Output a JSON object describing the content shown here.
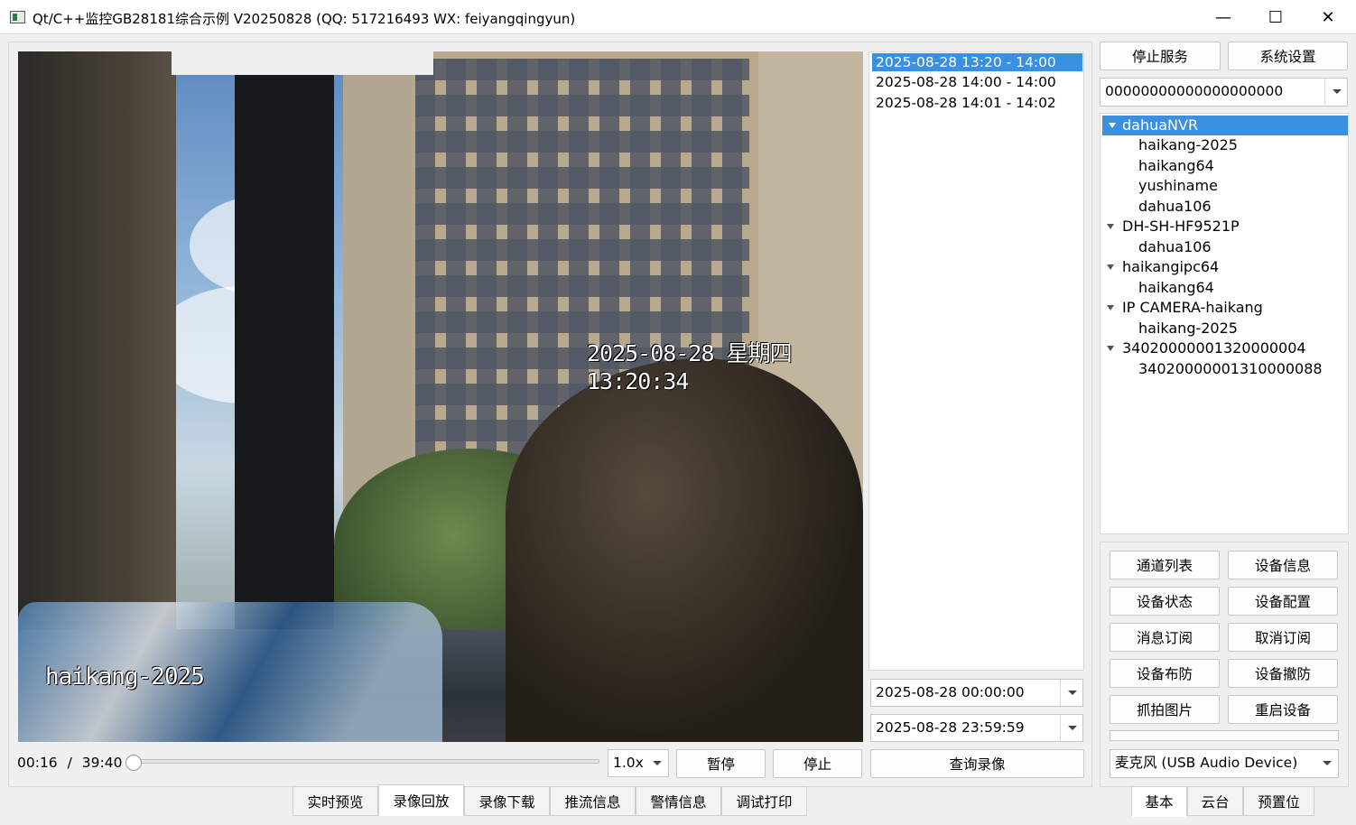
{
  "window": {
    "title": "Qt/C++监控GB28181综合示例 V20250828 (QQ: 517216493 WX: feiyangqingyun)",
    "minimize_glyph": "—",
    "maximize_glyph": "☐",
    "close_glyph": "✕"
  },
  "video": {
    "osd_time": "2025-08-28 星期四 13:20:34",
    "osd_name": "haikang-2025"
  },
  "records": [
    {
      "label": "2025-08-28 13:20 - 14:00",
      "selected": true
    },
    {
      "label": "2025-08-28 14:00 - 14:00",
      "selected": false
    },
    {
      "label": "2025-08-28 14:01 - 14:02",
      "selected": false
    }
  ],
  "query": {
    "start_time": "2025-08-28 00:00:00",
    "end_time": "2025-08-28 23:59:59",
    "query_button": "查询录像"
  },
  "playback": {
    "position": "00:16",
    "separator": "/",
    "duration": "39:40",
    "progress": 0.0067,
    "speed": "1.0x",
    "pause_button": "暂停",
    "stop_button": "停止"
  },
  "bottom_tabs": [
    "实时预览",
    "录像回放",
    "录像下载",
    "推流信息",
    "警情信息",
    "调试打印"
  ],
  "bottom_tab_active": 1,
  "right": {
    "stop_service": "停止服务",
    "system_settings": "系统设置",
    "device_id": "00000000000000000000",
    "tree": [
      {
        "label": "dahuaNVR",
        "level": 0,
        "expanded": true,
        "selected": true
      },
      {
        "label": "haikang-2025",
        "level": 1
      },
      {
        "label": "haikang64",
        "level": 1
      },
      {
        "label": "yushiname",
        "level": 1
      },
      {
        "label": "dahua106",
        "level": 1
      },
      {
        "label": "DH-SH-HF9521P",
        "level": 0,
        "expanded": true
      },
      {
        "label": "dahua106",
        "level": 1
      },
      {
        "label": "haikangipc64",
        "level": 0,
        "expanded": true
      },
      {
        "label": "haikang64",
        "level": 1
      },
      {
        "label": "IP CAMERA-haikang",
        "level": 0,
        "expanded": true
      },
      {
        "label": "haikang-2025",
        "level": 1
      },
      {
        "label": "34020000001320000004",
        "level": 0,
        "expanded": true
      },
      {
        "label": "34020000001310000088",
        "level": 1
      }
    ],
    "actions": [
      [
        "通道列表",
        "设备信息"
      ],
      [
        "设备状态",
        "设备配置"
      ],
      [
        "消息订阅",
        "取消订阅"
      ],
      [
        "设备布防",
        "设备撤防"
      ],
      [
        "抓拍图片",
        "重启设备"
      ]
    ],
    "audio_device": "麦克风 (USB Audio Device)",
    "tabs": [
      "基本",
      "云台",
      "预置位"
    ],
    "tab_active": 0
  },
  "colors": {
    "selection": "#3a8fdf",
    "window_bg": "#f0f0f0"
  }
}
